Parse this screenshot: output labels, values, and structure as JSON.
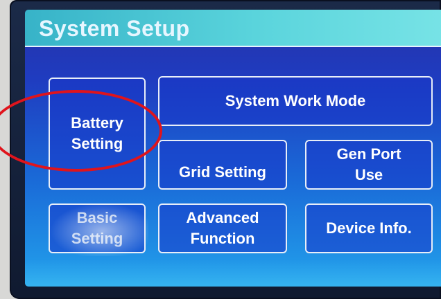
{
  "header": {
    "title": "System Setup"
  },
  "menu": {
    "battery_setting": "Battery\nSetting",
    "system_work_mode": "System Work Mode",
    "grid_setting": "Grid Setting",
    "gen_port_use": "Gen Port\nUse",
    "basic_setting": "Basic\nSetting",
    "advanced_function": "Advanced\nFunction",
    "device_info": "Device Info."
  },
  "colors": {
    "highlight_circle": "#e0141c",
    "title_bar": "#5ad4dc",
    "screen_bg": "#1f3cc0"
  }
}
